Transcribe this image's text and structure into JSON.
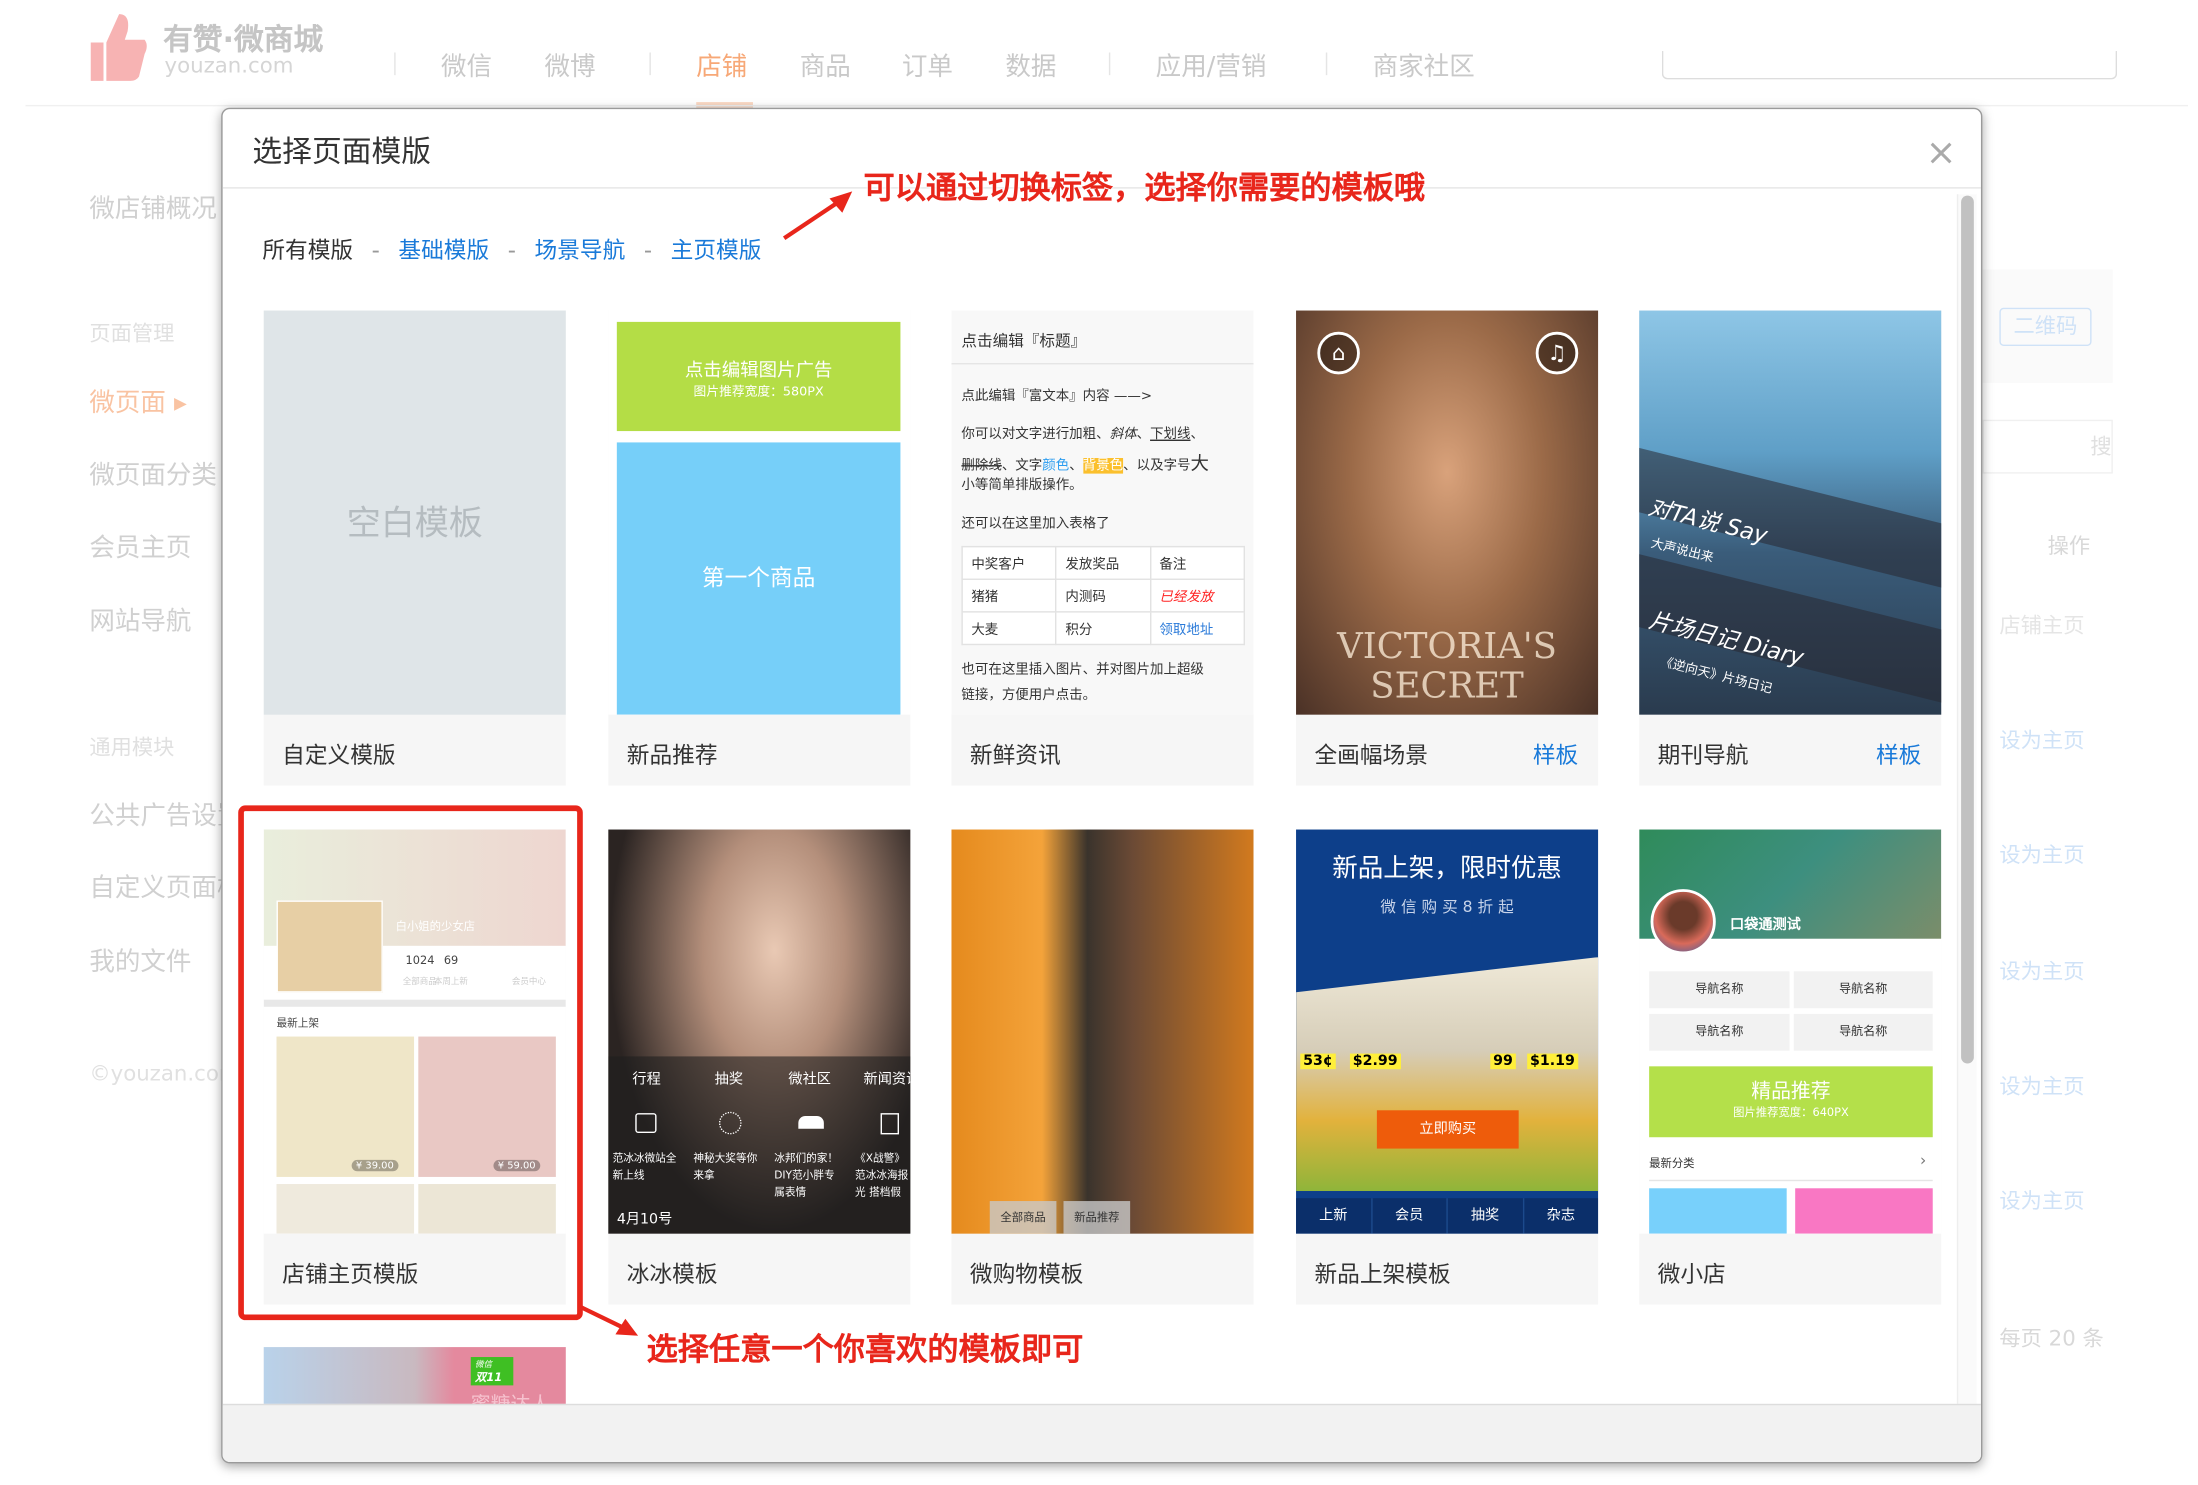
{
  "header": {
    "logo_title": "有赞·微商城",
    "logo_sub": "youzan.com",
    "nav": [
      "微信",
      "微博",
      "店铺",
      "商品",
      "订单",
      "数据",
      "应用/营销",
      "商家社区"
    ],
    "active_nav": "店铺",
    "accent": "#f79a5a"
  },
  "sidebar": {
    "items": [
      "微店铺概况",
      "页面管理",
      "微页面 ▸",
      "微页面分类",
      "会员主页",
      "网站导航",
      "通用模块",
      "公共广告设置",
      "自定义页面模块",
      "我的文件"
    ],
    "copyright": "©youzan.com"
  },
  "background_right": {
    "qr_button": "二维码",
    "search_placeholder": "搜索",
    "ops_header": "操作",
    "rows": [
      "店铺主页",
      "设为主页",
      "设为主页",
      "设为主页",
      "设为主页",
      "设为主页"
    ],
    "pager": "每页 20 条"
  },
  "modal": {
    "title": "选择页面模版",
    "close": "×",
    "tabs": [
      "所有模版",
      "基础模版",
      "场景导航",
      "主页模版"
    ],
    "tab_separator": "-",
    "link_color": "#1a7ad9",
    "annotations": {
      "top": "可以通过切换标签，选择你需要的模板哦",
      "bottom": "选择任意一个你喜欢的模板即可",
      "color": "#e8261b"
    },
    "sample_label": "样板",
    "cards": [
      {
        "label": "自定义模版",
        "preview": {
          "text": "空白模板"
        }
      },
      {
        "label": "新品推荐",
        "preview": {
          "ad_title": "点击编辑图片广告",
          "ad_sub": "图片推荐宽度：580PX",
          "product": "第一个商品"
        }
      },
      {
        "label": "新鲜资讯",
        "preview": {
          "title": "点击编辑『标题』",
          "p1": "点此编辑『富文本』内容 ——>",
          "p2a": "你可以对文字进行加粗、",
          "p2b": "斜体",
          "p2c": "、",
          "p2d": "下划线",
          "p2e": "、",
          "p3a": "删除线",
          "p3b": "、文字",
          "p3c": "颜色",
          "p3d": "、",
          "p3e": "背景色",
          "p3f": "、以及字号",
          "p3g": "大",
          "p4": "小等简单排版操作。",
          "p5": "还可以在这里加入表格了",
          "table": [
            [
              "中奖客户",
              "发放奖品",
              "备注"
            ],
            [
              "猪猪",
              "内测码",
              "已经发放"
            ],
            [
              "大麦",
              "积分",
              "领取地址"
            ]
          ],
          "p6": "也可在这里插入图片、并对图片加上超级",
          "p7": "链接，方便用户点击。"
        }
      },
      {
        "label": "全画幅场景",
        "sample": true,
        "preview": {
          "brand1": "VICTORIA'S",
          "brand2": "SECRET",
          "home_icon": "home-icon",
          "music_icon": "music-icon"
        }
      },
      {
        "label": "期刊导航",
        "sample": true,
        "preview": {
          "s1": "对TA说  Say",
          "s1b": "大声说出来",
          "s2": "片场日记  Diary",
          "s2b": "《逆向天》片场日记"
        }
      },
      {
        "label": "店铺主页模版",
        "preview": {
          "shop": "白小姐的少女店",
          "stats": [
            {
              "n": "1024",
              "l": "全部商品"
            },
            {
              "n": "69",
              "l": "本周上新"
            },
            {
              "n": "",
              "l": "会员中心"
            }
          ],
          "section": "最新上架",
          "prices": [
            "¥ 39.00",
            "¥ 59.00"
          ]
        }
      },
      {
        "label": "冰冰模板",
        "preview": {
          "nav": [
            "行程",
            "抽奖",
            "微社区",
            "新闻资讯"
          ],
          "items": [
            "范冰冰微站全新上线",
            "神秘大奖等你来拿",
            "冰邦们的家！DIY范小胖专属表情",
            "《X战警》范冰冰海报光 搭档假"
          ],
          "date": "4月10号"
        }
      },
      {
        "label": "微购物模板",
        "preview": {
          "buttons": [
            "全部商品",
            "新品推荐"
          ]
        }
      },
      {
        "label": "新品上架模板",
        "preview": {
          "title": "新品上架，限时优惠",
          "sub": "微 信 购 买 8 折 起",
          "cta": "立即购买",
          "prices": [
            "53¢",
            "$2.99",
            "99",
            "$1.19"
          ],
          "nav": [
            "上新",
            "会员",
            "抽奖",
            "杂志"
          ]
        }
      },
      {
        "label": "微小店",
        "preview": {
          "name": "口袋通测试",
          "navs": [
            "导航名称",
            "导航名称",
            "导航名称",
            "导航名称"
          ],
          "banner": "精品推荐",
          "banner_sub": "图片推荐宽度：640PX",
          "section": "最新分类"
        }
      },
      {
        "label": "",
        "preview": {
          "badge1": "微信",
          "badge2": "双11",
          "text": "蜜糖达人"
        }
      }
    ]
  }
}
